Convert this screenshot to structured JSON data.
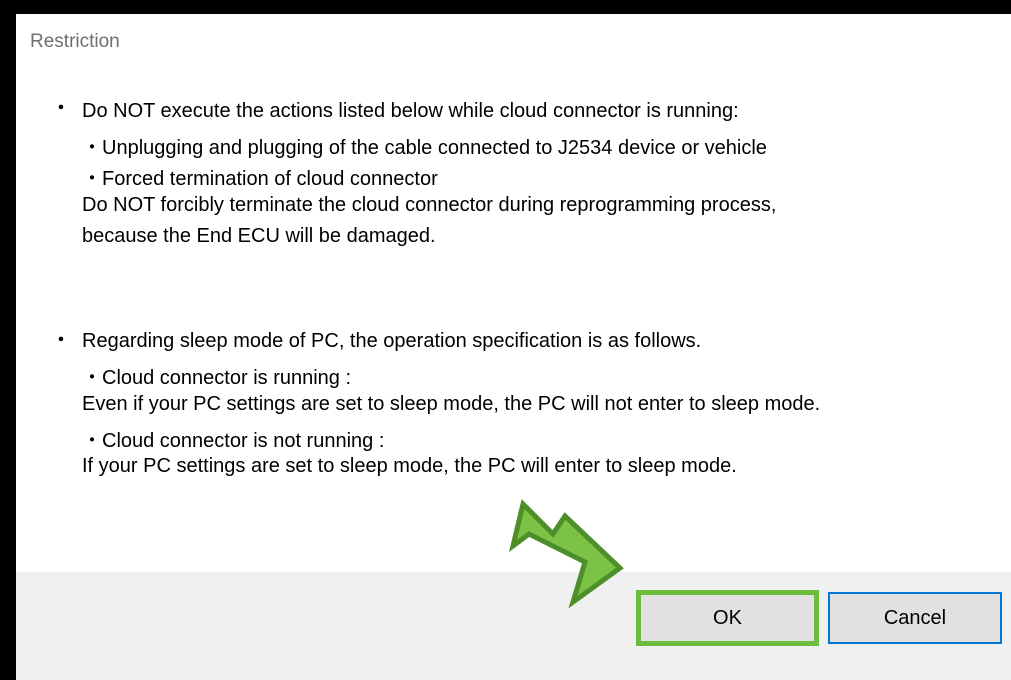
{
  "dialog": {
    "title": "Restriction",
    "section1": {
      "bullet": "・",
      "heading": "Do NOT execute the actions listed below while cloud connector is running:",
      "item1": "・Unplugging and plugging of the cable connected to J2534 device or vehicle",
      "item2": "・Forced termination of cloud connector",
      "note1": "Do NOT forcibly terminate the cloud connector during reprogramming process,",
      "note2": "because the End ECU will be damaged."
    },
    "section2": {
      "bullet": "・",
      "heading": "Regarding sleep mode of PC, the operation specification is as follows.",
      "item1": "・Cloud connector is running :",
      "detail1": "Even if your PC settings are set to sleep mode, the PC will not enter to sleep mode.",
      "item2": "・Cloud connector is not running :",
      "detail2": "If your PC settings are set to sleep mode, the PC will enter to sleep mode."
    },
    "buttons": {
      "ok": "OK",
      "cancel": "Cancel"
    }
  },
  "colors": {
    "highlight": "#6cbd3e",
    "focus": "#0078d7"
  },
  "annotation": {
    "icon": "green-arrow-icon"
  }
}
